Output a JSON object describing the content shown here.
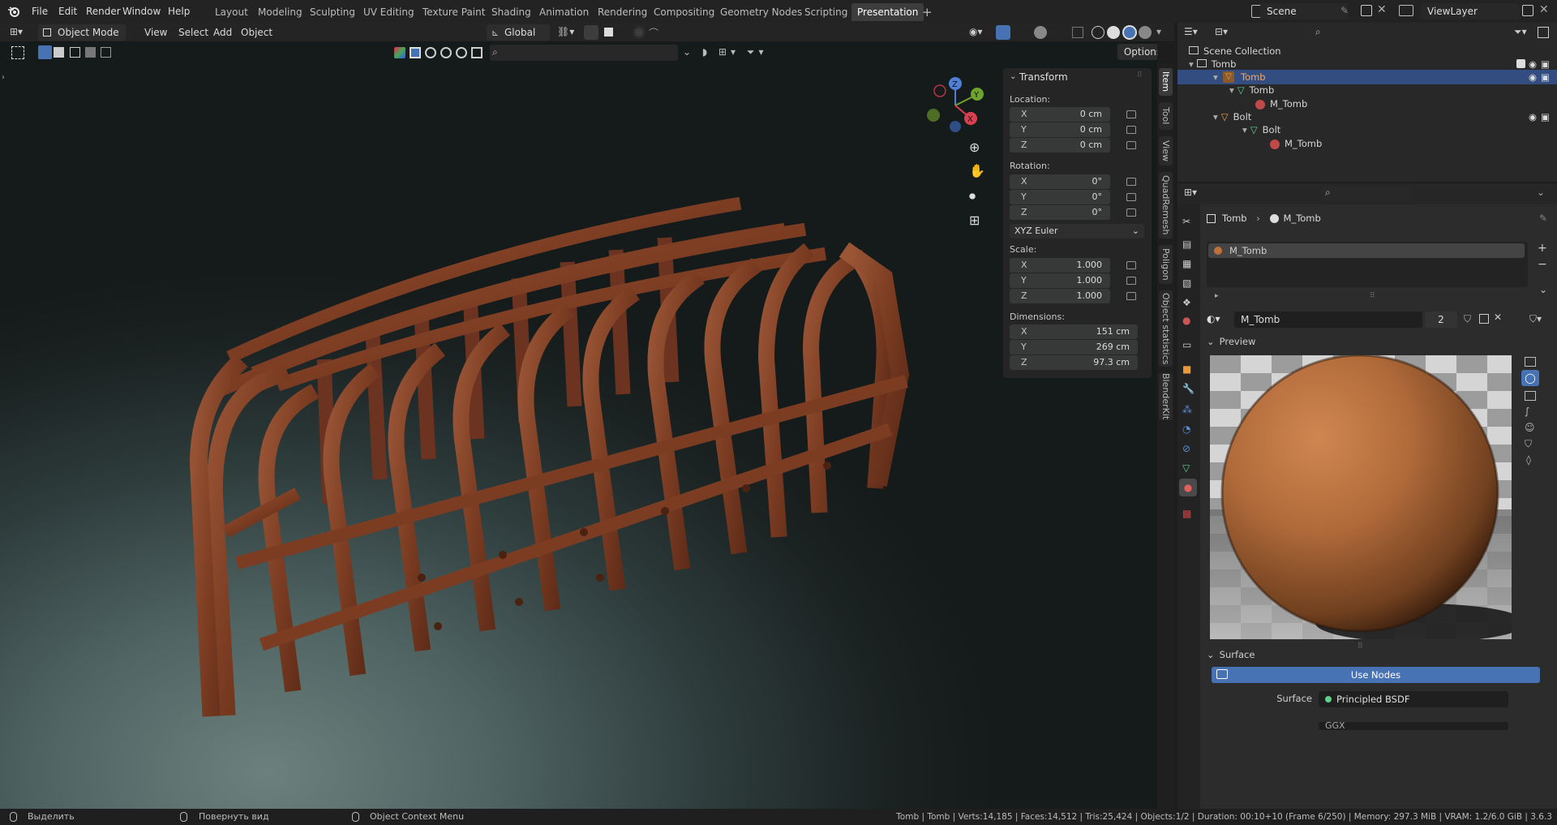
{
  "top_menu": [
    "File",
    "Edit",
    "Render",
    "Window",
    "Help"
  ],
  "workspaces": [
    "Layout",
    "Modeling",
    "Sculpting",
    "UV Editing",
    "Texture Paint",
    "Shading",
    "Animation",
    "Rendering",
    "Compositing",
    "Geometry Nodes",
    "Scripting",
    "Presentation"
  ],
  "active_workspace": "Presentation",
  "add_workspace": "+",
  "scene_name": "Scene",
  "view_layer": "ViewLayer",
  "viewport_header": {
    "mode": "Object Mode",
    "menus": [
      "View",
      "Select",
      "Add",
      "Object"
    ],
    "orientation": "Global",
    "options": "Options"
  },
  "npanel": {
    "section": "Transform",
    "location_label": "Location:",
    "location": [
      {
        "axis": "X",
        "value": "0 cm"
      },
      {
        "axis": "Y",
        "value": "0 cm"
      },
      {
        "axis": "Z",
        "value": "0 cm"
      }
    ],
    "rotation_label": "Rotation:",
    "rotation": [
      {
        "axis": "X",
        "value": "0°"
      },
      {
        "axis": "Y",
        "value": "0°"
      },
      {
        "axis": "Z",
        "value": "0°"
      }
    ],
    "rotation_mode": "XYZ Euler",
    "scale_label": "Scale:",
    "scale": [
      {
        "axis": "X",
        "value": "1.000"
      },
      {
        "axis": "Y",
        "value": "1.000"
      },
      {
        "axis": "Z",
        "value": "1.000"
      }
    ],
    "dimensions_label": "Dimensions:",
    "dimensions": [
      {
        "axis": "X",
        "value": "151 cm"
      },
      {
        "axis": "Y",
        "value": "269 cm"
      },
      {
        "axis": "Z",
        "value": "97.3 cm"
      }
    ]
  },
  "side_tabs": [
    "Item",
    "Tool",
    "View",
    "QuadRemesh",
    "Poligon",
    "Object statistics",
    "BlenderKit"
  ],
  "outliner": {
    "root": "Scene Collection",
    "items": [
      {
        "label": "Tomb",
        "level": 1
      },
      {
        "label": "Tomb",
        "level": 2,
        "selected": true
      },
      {
        "label": "Tomb",
        "level": 3
      },
      {
        "label": "M_Tomb",
        "level": 4
      },
      {
        "label": "Bolt",
        "level": 2
      },
      {
        "label": "Bolt",
        "level": 3
      },
      {
        "label": "M_Tomb",
        "level": 4
      }
    ]
  },
  "properties": {
    "breadcrumb_object": "Tomb",
    "breadcrumb_material": "M_Tomb",
    "slot": "M_Tomb",
    "material_name": "M_Tomb",
    "users": "2",
    "preview_label": "Preview",
    "surface_label": "Surface",
    "use_nodes": "Use Nodes",
    "surface_field_label": "Surface",
    "surface_shader": "Principled BSDF",
    "next_field": "GGX"
  },
  "status": {
    "left_action": "Выделить",
    "mid_action": "Повернуть вид",
    "context": "Object Context Menu",
    "stats": "Tomb | Tomb | Verts:14,185 | Faces:14,512 | Tris:25,424 | Objects:1/2 | Duration: 00:10+10 (Frame 6/250) | Memory: 297.3 MiB | VRAM: 1.2/6.0 GiB | 3.6.3"
  },
  "colors": {
    "accent": "#4772b3",
    "selected_row": "#334d80",
    "rust": "#7a3a20"
  }
}
